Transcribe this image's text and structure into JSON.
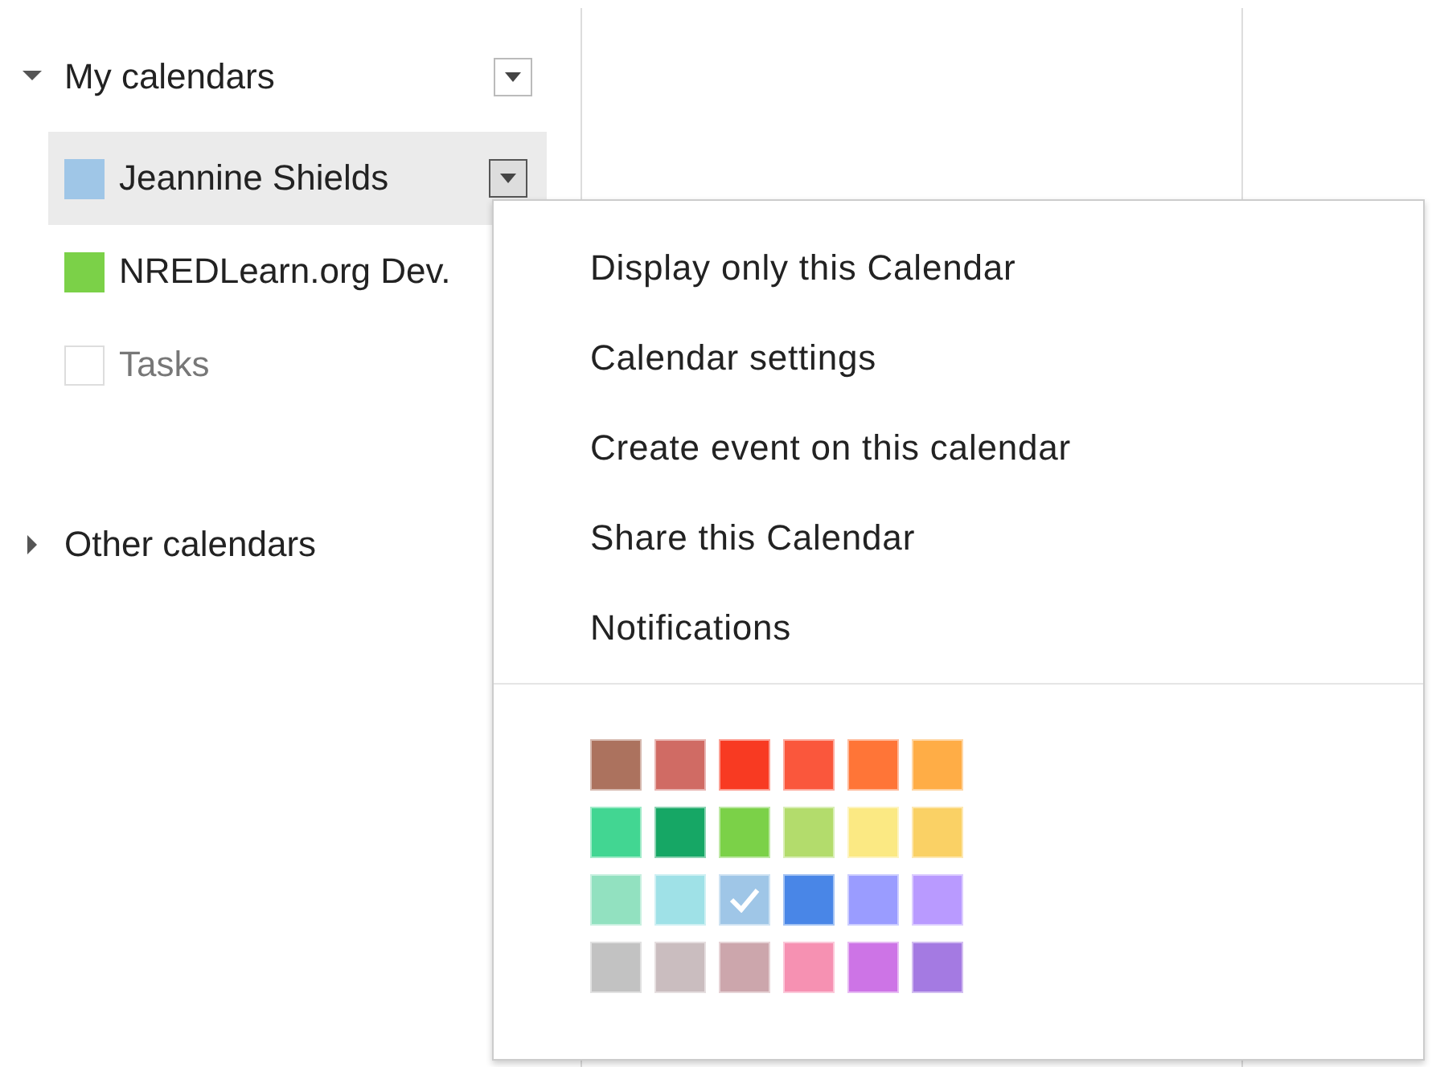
{
  "sidebar": {
    "my_calendars": {
      "label": "My calendars",
      "expanded": true,
      "calendars": [
        {
          "name": "Jeannine Shields",
          "color": "#9fc6e7",
          "checked": true,
          "selected": true
        },
        {
          "name": "NREDLearn.org Dev.",
          "color": "#7bd148",
          "checked": true,
          "selected": false
        },
        {
          "name": "Tasks",
          "checked": false,
          "selected": false
        }
      ]
    },
    "other_calendars": {
      "label": "Other calendars",
      "expanded": false
    }
  },
  "menu": {
    "items": [
      "Display only this Calendar",
      "Calendar settings",
      "Create event on this calendar",
      "Share this Calendar",
      "Notifications"
    ],
    "palette": [
      [
        {
          "color": "#ac725e",
          "selected": false
        },
        {
          "color": "#d06b64",
          "selected": false
        },
        {
          "color": "#f83a22",
          "selected": false
        },
        {
          "color": "#fa573c",
          "selected": false
        },
        {
          "color": "#ff7537",
          "selected": false
        },
        {
          "color": "#ffad46",
          "selected": false
        }
      ],
      [
        {
          "color": "#42d692",
          "selected": false
        },
        {
          "color": "#16a765",
          "selected": false
        },
        {
          "color": "#7bd148",
          "selected": false
        },
        {
          "color": "#b3dc6c",
          "selected": false
        },
        {
          "color": "#fbe983",
          "selected": false
        },
        {
          "color": "#fad165",
          "selected": false
        }
      ],
      [
        {
          "color": "#92e1c0",
          "selected": false
        },
        {
          "color": "#9fe1e7",
          "selected": false
        },
        {
          "color": "#9fc6e7",
          "selected": true
        },
        {
          "color": "#4986e7",
          "selected": false
        },
        {
          "color": "#9a9cff",
          "selected": false
        },
        {
          "color": "#b99aff",
          "selected": false
        }
      ],
      [
        {
          "color": "#c2c2c2",
          "selected": false
        },
        {
          "color": "#cabdbf",
          "selected": false
        },
        {
          "color": "#cca6ac",
          "selected": false
        },
        {
          "color": "#f691b2",
          "selected": false
        },
        {
          "color": "#cd74e6",
          "selected": false
        },
        {
          "color": "#a47ae2",
          "selected": false
        }
      ]
    ]
  }
}
